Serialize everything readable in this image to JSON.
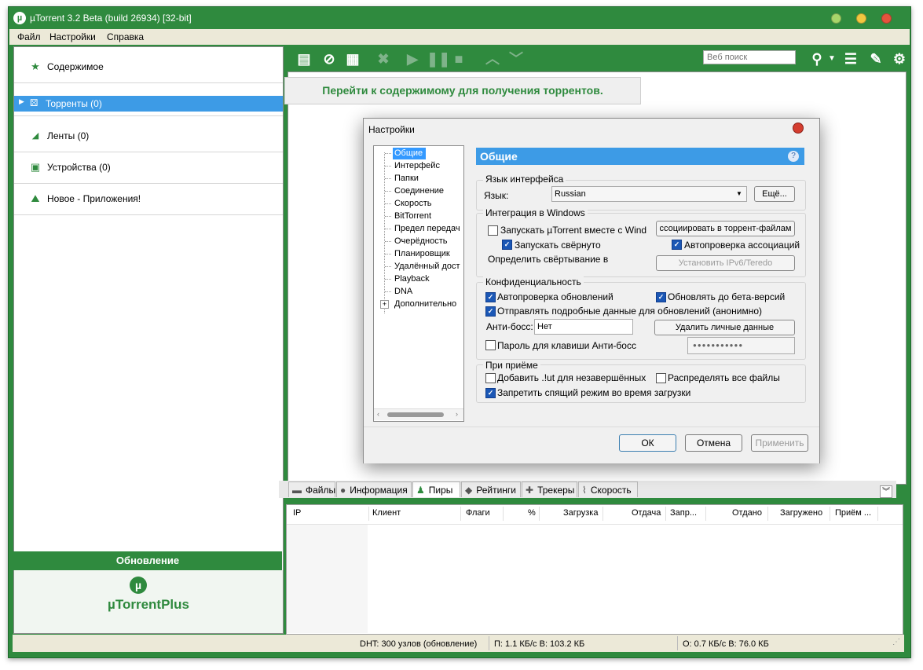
{
  "window": {
    "title": "µTorrent 3.2 Beta (build 26934) [32-bit]"
  },
  "menu": [
    "Файл",
    "Настройки",
    "Справка"
  ],
  "sidebar": {
    "items": [
      {
        "label": "Содержимое"
      },
      {
        "label": "Торренты (0)"
      },
      {
        "label": "Ленты (0)"
      },
      {
        "label": "Устройства (0)"
      },
      {
        "label": "Новое - Приложения!"
      }
    ],
    "update_label": "Обновление",
    "plus_logo": "µTorrentPlus"
  },
  "toolbar": {
    "search_placeholder": "Веб поиск"
  },
  "banner": {
    "text": "Перейти к содержимому для получения торрентов."
  },
  "bottom_tabs": [
    "Файлы",
    "Информация",
    "Пиры",
    "Рейтинги",
    "Трекеры",
    "Скорость"
  ],
  "peers_columns": [
    "IP",
    "Клиент",
    "Флаги",
    "%",
    "Загрузка",
    "Отдача",
    "Запр...",
    "Отдано",
    "Загружено",
    "Приём ..."
  ],
  "statusbar": {
    "dht": "DHT: 300 узлов  (обновление)",
    "download": "П: 1.1 КБ/с В: 103.2 КБ",
    "upload": "О: 0.7 КБ/с В: 76.0 КБ"
  },
  "dialog": {
    "title": "Настройки",
    "tree": [
      "Общие",
      "Интерфейс",
      "Папки",
      "Соединение",
      "Скорость",
      "BitTorrent",
      "Предел передач",
      "Очерёдность",
      "Планировщик",
      "Удалённый дост",
      "Playback",
      "DNA",
      "Дополнительно"
    ],
    "page_title": "Общие",
    "language": {
      "group": "Язык интерфейса",
      "label": "Язык:",
      "value": "Russian",
      "more_button": "Ещё..."
    },
    "windows": {
      "group": "Интеграция в Windows",
      "start_with_windows": "Запускать µTorrent вместе с Wind",
      "associate_button": "ссоциировать в торрент-файлам",
      "start_minimized": "Запускать свёрнуто",
      "check_associations": "Автопроверка ассоциаций",
      "minimize_label": "Определить свёртывание в",
      "ipv6_button": "Установить IPv6/Teredo"
    },
    "privacy": {
      "group": "Конфиденциальность",
      "auto_updates": "Автопроверка обновлений",
      "beta_updates": "Обновлять до бета-версий",
      "send_data": "Отправлять подробные данные для обновлений (анонимно)",
      "boss_label": "Анти-босс:",
      "boss_value": "Нет",
      "delete_button": "Удалить личные данные",
      "boss_password": "Пароль для клавиши Анти-босс",
      "password_mask": "●●●●●●●●●●●"
    },
    "download": {
      "group": "При приёме",
      "append_ut": "Добавить .!ut для незавершённых",
      "preallocate": "Распределять все файлы",
      "prevent_sleep": "Запретить спящий режим во время загрузки"
    },
    "buttons": {
      "ok": "ОК",
      "cancel": "Отмена",
      "apply": "Применить"
    }
  }
}
